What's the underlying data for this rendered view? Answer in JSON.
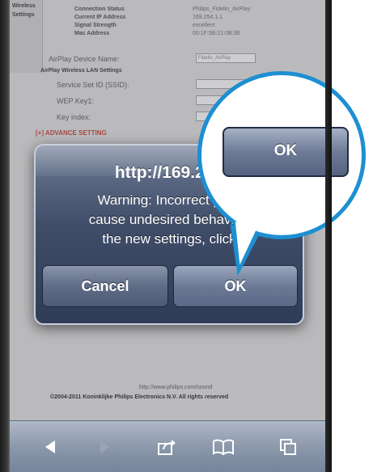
{
  "sidebar": {
    "lines": [
      "Wireless",
      "Settings"
    ]
  },
  "status": {
    "labels": [
      "Connection Status",
      "Current IP Address",
      "Signal Strength",
      "Mac Address"
    ],
    "values": [
      "Philips_Fidelio_AirPlay",
      "169.254.1.1",
      "excellent",
      "00:1F:5B:21:0B:3E"
    ]
  },
  "form": {
    "device_name_label": "AirPlay Device Name:",
    "device_name_value": "Fidelio_AirPlay",
    "section_title": "AirPlay Wireless LAN Settings",
    "ssid_label": "Service Set ID (SSID):",
    "wep_label": "WEP Key1:",
    "key_index_label": "Key index:",
    "advance": "[+] ADVANCE SETTING"
  },
  "alert": {
    "title": "http://169.254",
    "line1": "Warning: Incorrect para",
    "line2": "cause undesired behavior.",
    "line3": "the new settings, click",
    "cancel_label": "Cancel",
    "ok_label": "OK"
  },
  "magnifier": {
    "ok_label": "OK"
  },
  "footer": {
    "url": "http://www.philips.com/sound",
    "copyright": "©2004-2011 Koninklijke Philips Electronics N.V. All rights reserved"
  },
  "toolbar": {
    "icons": [
      "back-icon",
      "forward-icon",
      "share-icon",
      "bookmarks-icon",
      "tabs-icon"
    ]
  },
  "colors": {
    "accent_callout": "#1d8fd2",
    "alert_bg": "#3f4d69",
    "advance_red": "#c0392b"
  }
}
